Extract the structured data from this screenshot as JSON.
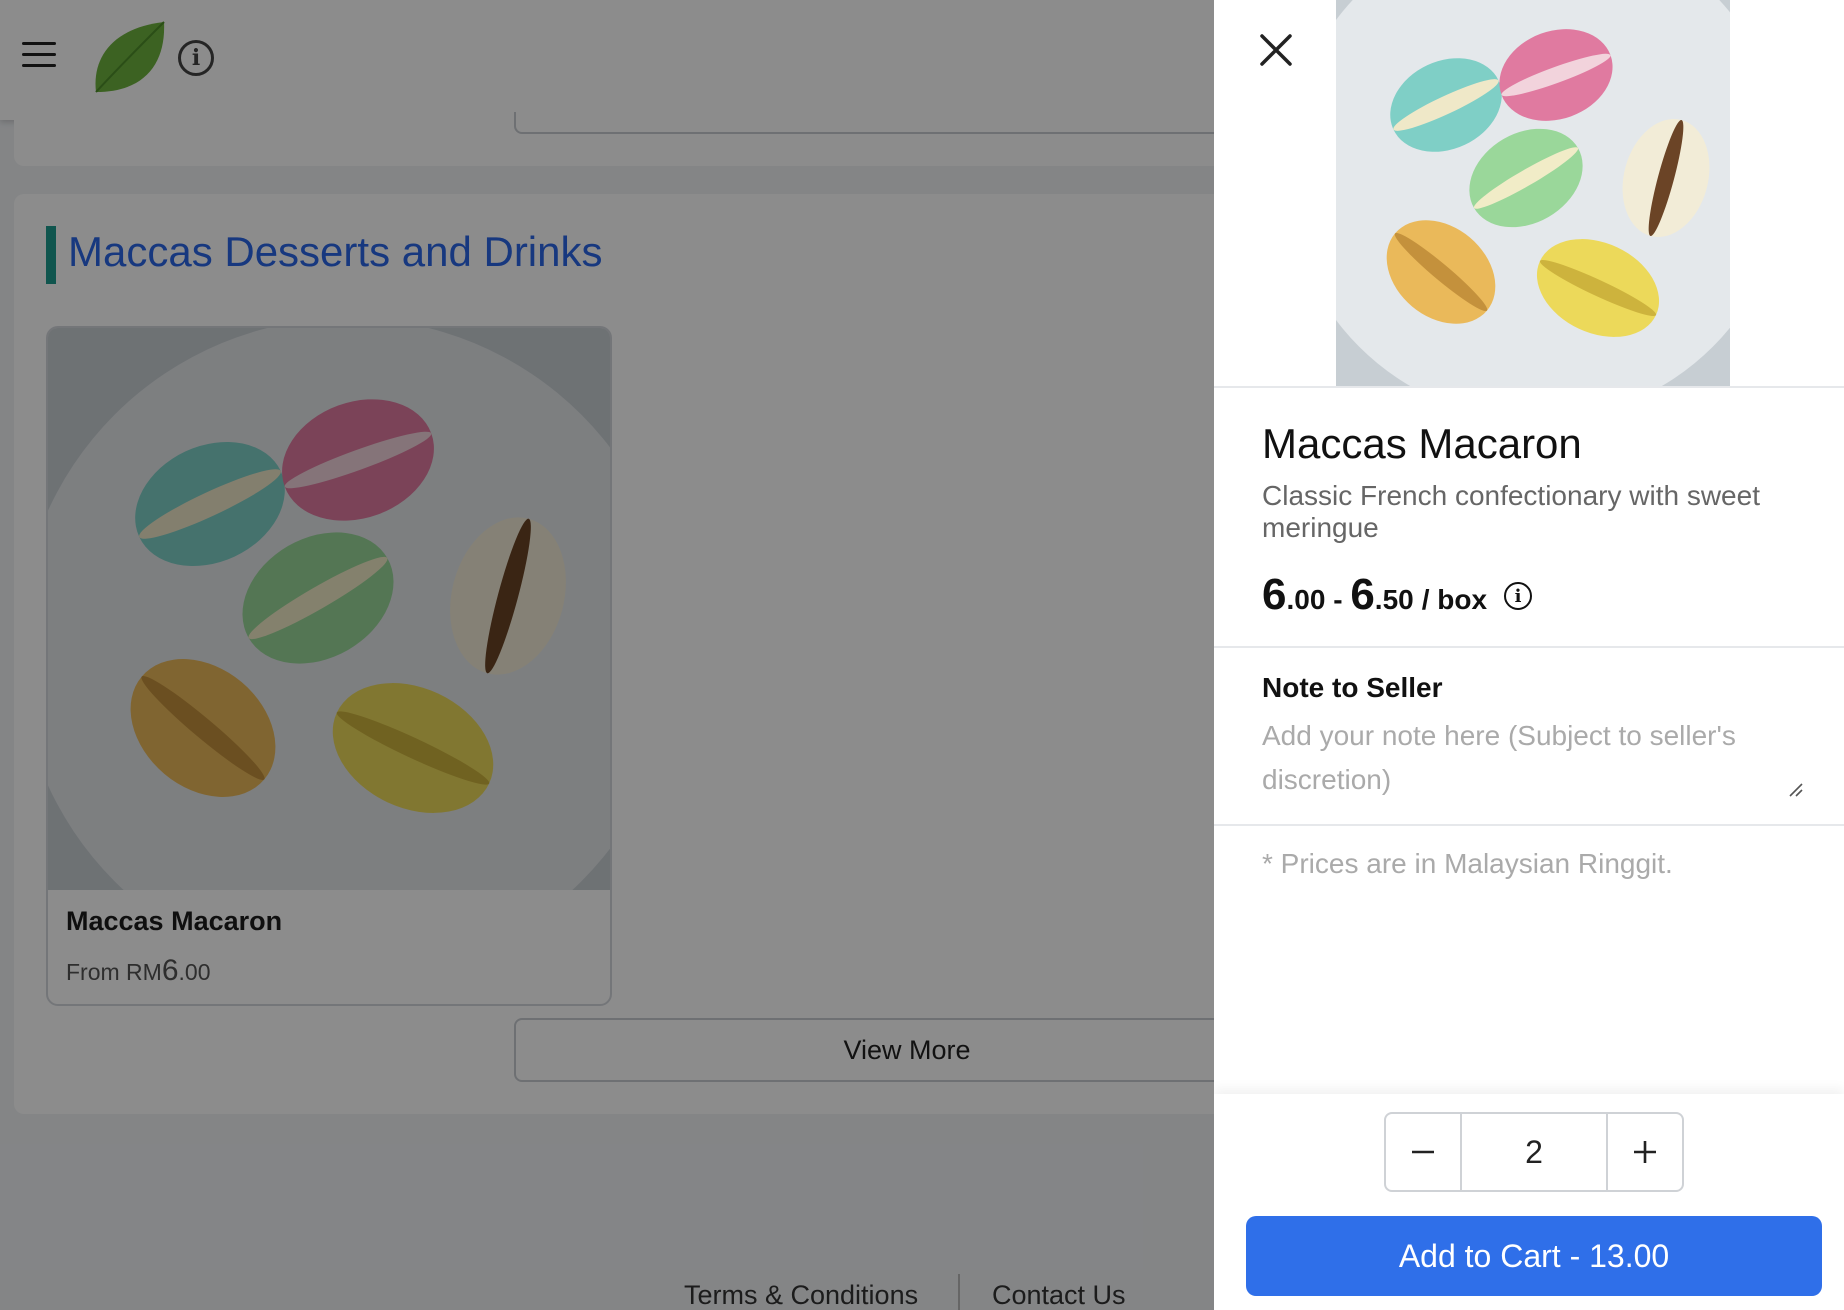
{
  "header": {
    "menu_icon": "hamburger-menu-icon",
    "logo_icon": "leaf-logo-icon",
    "info_icon": "info-icon",
    "info_glyph": "i"
  },
  "section": {
    "title": "Maccas Desserts and Drinks"
  },
  "products": [
    {
      "name": "Maccas Macaron",
      "price_prefix": "From RM",
      "price_major": "6",
      "price_minor": ".00"
    }
  ],
  "view_more_label": "View More",
  "footer": {
    "terms_label": "Terms & Conditions",
    "contact_label": "Contact Us"
  },
  "drawer": {
    "close_icon": "close-icon",
    "title": "Maccas Macaron",
    "description": "Classic French confectionary with sweet meringue",
    "price": {
      "min_major": "6",
      "min_minor": ".00",
      "separator": " - ",
      "max_major": "6",
      "max_minor": ".50",
      "unit": "/ box"
    },
    "price_info_glyph": "i",
    "note_label": "Note to Seller",
    "note_placeholder": "Add your note here (Subject to seller's discretion)",
    "note_value": "",
    "prices_note": "* Prices are in Malaysian Ringgit.",
    "quantity": "2",
    "add_to_cart_label": "Add to Cart - 13.00"
  },
  "colors": {
    "accent_blue": "#2f6fe9",
    "title_blue": "#2a67e8",
    "section_accent": "#1e9c8f",
    "leaf_green": "#6db33f"
  }
}
